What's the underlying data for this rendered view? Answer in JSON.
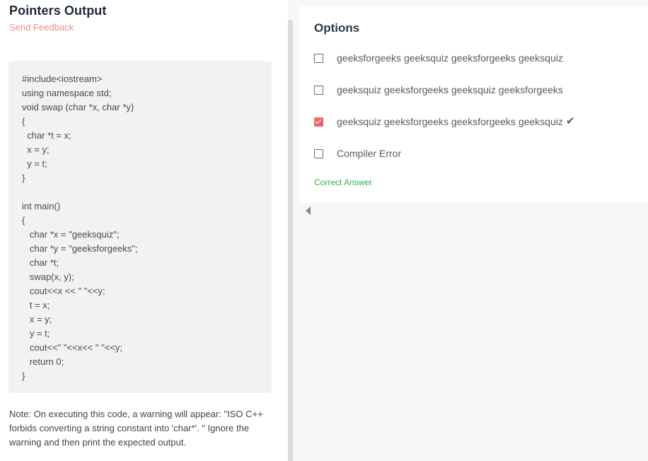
{
  "question": {
    "title": "Pointers Output",
    "feedback_link": "Send Feedback",
    "code_lines": [
      "#include<iostream>",
      "using namespace std;",
      "void swap (char *x, char *y)",
      "{",
      "  char *t = x;",
      "  x = y;",
      "  y = t;",
      "}",
      "",
      "int main()",
      "{",
      "   char *x = \"geeksquiz\";",
      "   char *y = \"geeksforgeeks\";",
      "   char *t;",
      "   swap(x, y);",
      "   cout<<x << \" \"<<y;",
      "   t = x;",
      "   x = y;",
      "   y = t;",
      "   cout<<\" \"<<x<< \" \"<<y;",
      "   return 0;",
      "}"
    ],
    "note": "Note: On executing this code, a warning will appear: \"ISO C++ forbids converting a string constant into 'char*'. \" Ignore the warning and then print the expected output."
  },
  "options": {
    "title": "Options",
    "items": [
      {
        "label": "geeksforgeeks geeksquiz geeksforgeeks geeksquiz",
        "checked": false,
        "correct_mark": false
      },
      {
        "label": "geeksquiz geeksforgeeks geeksquiz geeksforgeeks",
        "checked": false,
        "correct_mark": false
      },
      {
        "label": "geeksquiz geeksforgeeks geeksforgeeks geeksquiz",
        "checked": true,
        "correct_mark": true
      },
      {
        "label": "Compiler Error",
        "checked": false,
        "correct_mark": false
      }
    ],
    "result_text": "Correct Answer",
    "result_color": "#2fb344",
    "accent_color": "#ee4e7e",
    "tick_icon": "checkmark-icon",
    "tick_glyph": "✔"
  }
}
